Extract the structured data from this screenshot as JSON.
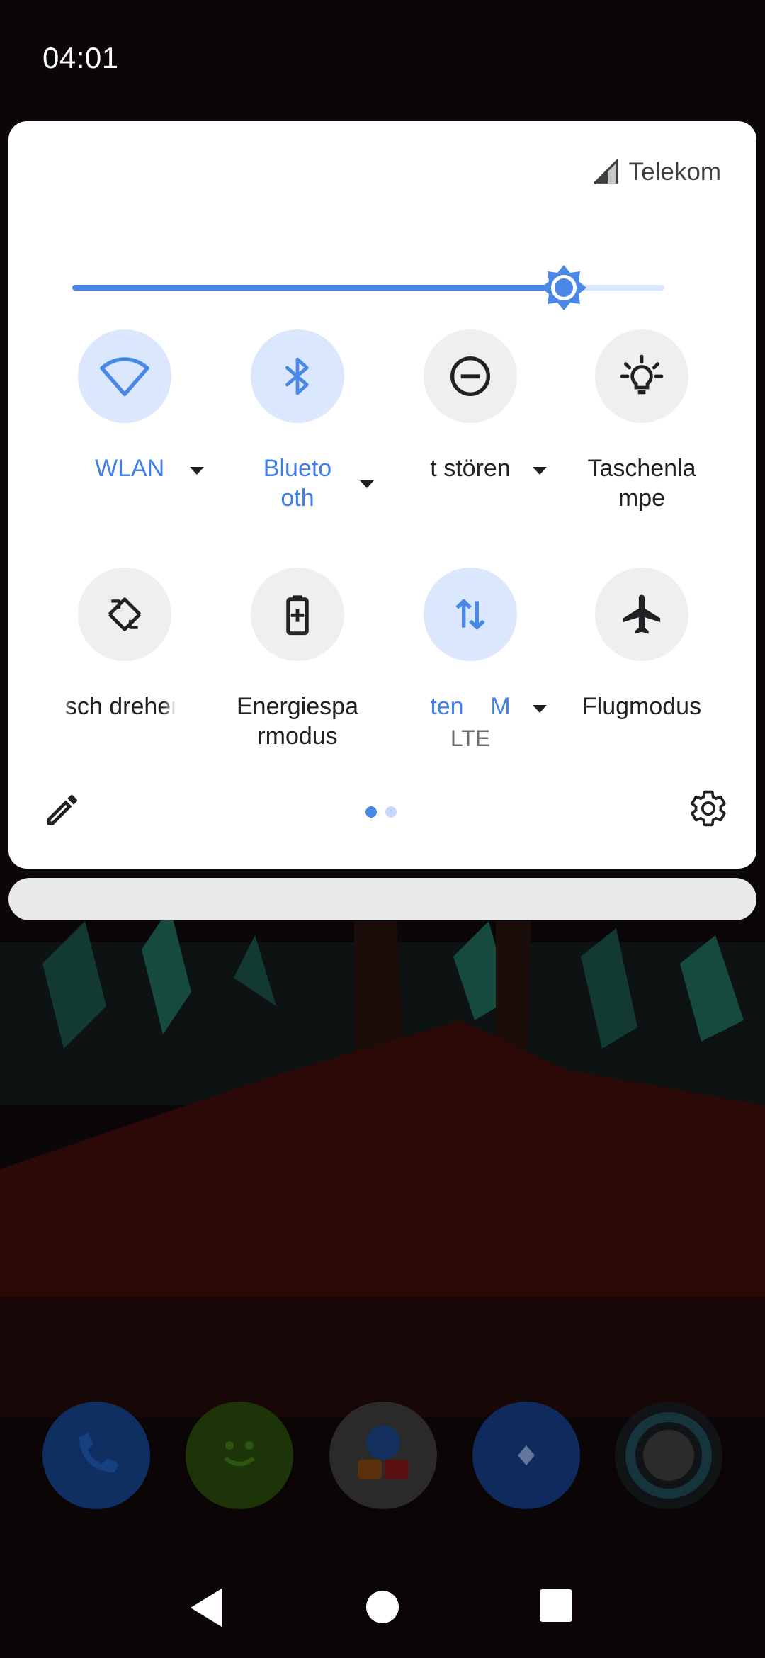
{
  "status_bar": {
    "time": "04:01"
  },
  "quick_settings": {
    "carrier": "Telekom",
    "brightness_level": 0.83,
    "tiles": [
      {
        "id": "wlan",
        "label": "WLAN",
        "icon": "wifi-icon",
        "on": true,
        "has_dropdown": true
      },
      {
        "id": "bluetooth",
        "label": "Blueto\noth",
        "icon": "bluetooth-icon",
        "on": true,
        "has_dropdown": true
      },
      {
        "id": "dnd",
        "label": "t stören",
        "icon": "do-not-disturb-icon",
        "on": false,
        "has_dropdown": true
      },
      {
        "id": "flashlight",
        "label": "Taschenla\nmpe",
        "icon": "flashlight-icon",
        "on": false,
        "has_dropdown": false
      },
      {
        "id": "autorotate",
        "label": "sch drehen",
        "icon": "auto-rotate-icon",
        "on": false,
        "has_dropdown": false
      },
      {
        "id": "battery-saver",
        "label": "Energiespa\nrmodus",
        "icon": "battery-saver-icon",
        "on": false,
        "has_dropdown": false
      },
      {
        "id": "mobile-data",
        "label": "ten    M",
        "sublabel": "LTE",
        "icon": "mobile-data-icon",
        "on": true,
        "has_dropdown": true
      },
      {
        "id": "airplane",
        "label": "Flugmodus",
        "icon": "airplane-icon",
        "on": false,
        "has_dropdown": false
      }
    ],
    "page_count": 2,
    "current_page": 1
  },
  "dock": [
    "phone-icon",
    "messages-icon",
    "duo-icon",
    "maps-icon",
    "assistant-icon"
  ],
  "colors": {
    "accent": "#4a88e8",
    "tile_on_bg": "#dbe7fc",
    "tile_off_bg": "#efefef",
    "panel_bg": "#ffffff"
  }
}
